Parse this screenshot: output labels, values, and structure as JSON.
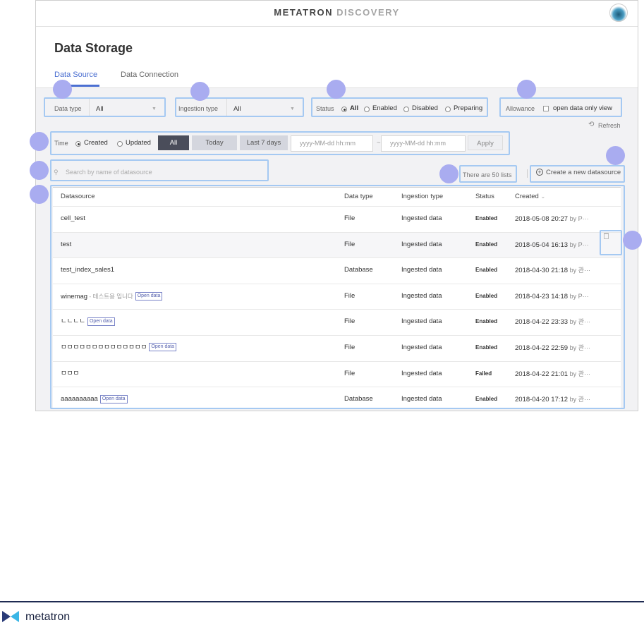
{
  "app": {
    "brand_main": "METATRON",
    "brand_sub": " DISCOVERY"
  },
  "page": {
    "title": "Data Storage"
  },
  "tabs": [
    {
      "label": "Data Source"
    },
    {
      "label": "Data Connection"
    }
  ],
  "filters": {
    "data_type": {
      "label": "Data type",
      "value": "All"
    },
    "ingestion_type": {
      "label": "Ingestion type",
      "value": "All"
    },
    "status": {
      "label": "Status",
      "options": [
        "All",
        "Enabled",
        "Disabled",
        "Preparing"
      ],
      "selected": "All"
    },
    "allowance": {
      "label": "Allowance",
      "checkbox": "open data only view"
    },
    "refresh": "Refresh",
    "time": {
      "label": "Time",
      "options": [
        "Created",
        "Updated"
      ],
      "selected": "Created",
      "ranges": [
        "All",
        "Today",
        "Last 7 days"
      ],
      "active_range": "All",
      "from_placeholder": "yyyy-MM-dd hh:mm",
      "separator": "~",
      "to_placeholder": "yyyy-MM-dd hh:mm",
      "apply": "Apply"
    }
  },
  "search": {
    "placeholder": "Search by name of datasource"
  },
  "list_count": "There are 50 lists",
  "create_button": "Create a new datasource",
  "table": {
    "columns": [
      "Datasource",
      "Data type",
      "Ingestion type",
      "Status",
      "Created"
    ],
    "sort_indicator": "⌄",
    "open_data_badge": "Open data",
    "rows": [
      {
        "name": "cell_test",
        "note": "",
        "open_data": false,
        "type": "File",
        "ingestion": "Ingested data",
        "status": "Enabled",
        "created": "2018-05-08 20:27",
        "by": "by P···"
      },
      {
        "name": "test",
        "note": "",
        "open_data": false,
        "type": "File",
        "ingestion": "Ingested data",
        "status": "Enabled",
        "created": "2018-05-04 16:13",
        "by": "by P···"
      },
      {
        "name": "test_index_sales1",
        "note": "",
        "open_data": false,
        "type": "Database",
        "ingestion": "Ingested data",
        "status": "Enabled",
        "created": "2018-04-30 21:18",
        "by": "by 관···"
      },
      {
        "name": "winemag",
        "note": " - 테스트용 입니다",
        "open_data": true,
        "type": "File",
        "ingestion": "Ingested data",
        "status": "Enabled",
        "created": "2018-04-23 14:18",
        "by": "by P···"
      },
      {
        "name": "ㄴㄴㄴㄴ",
        "note": "",
        "open_data": true,
        "type": "File",
        "ingestion": "Ingested data",
        "status": "Enabled",
        "created": "2018-04-22 23:33",
        "by": "by 관···"
      },
      {
        "name": "ㅁㅁㅁㅁㅁㅁㅁㅁㅁㅁㅁㅁㅁㅁ",
        "note": "",
        "open_data": true,
        "type": "File",
        "ingestion": "Ingested data",
        "status": "Enabled",
        "created": "2018-04-22 22:59",
        "by": "by 관···"
      },
      {
        "name": "ㅁㅁㅁ",
        "note": "",
        "open_data": false,
        "type": "File",
        "ingestion": "Ingested data",
        "status": "Failed",
        "created": "2018-04-22 21:01",
        "by": "by 관···"
      },
      {
        "name": "aaaaaaaaaa",
        "note": "",
        "open_data": true,
        "type": "Database",
        "ingestion": "Ingested data",
        "status": "Enabled",
        "created": "2018-04-20 17:12",
        "by": "by 관···"
      }
    ]
  },
  "footer": {
    "logo_text": "metatron"
  },
  "colors": {
    "accent": "#4b6fd1",
    "highlight": "#a5c9f2",
    "marker": "#a9acf0",
    "footer": "#1e2a52"
  }
}
